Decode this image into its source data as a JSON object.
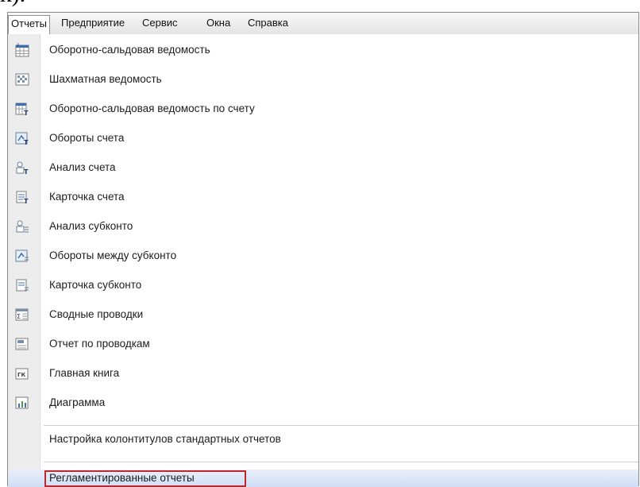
{
  "fragment_text": "к).",
  "menubar": {
    "items": [
      "Отчеты",
      "Предприятие",
      "Сервис",
      "Окна",
      "Справка"
    ]
  },
  "menu": {
    "items": [
      {
        "label": "Оборотно-сальдовая ведомость",
        "icon": "turnover-balance-icon"
      },
      {
        "label": "Шахматная ведомость",
        "icon": "chess-sheet-icon"
      },
      {
        "label": "Оборотно-сальдовая ведомость по счету",
        "icon": "account-turnover-balance-icon"
      },
      {
        "label": "Обороты счета",
        "icon": "account-turnover-icon"
      },
      {
        "label": "Анализ счета",
        "icon": "account-analysis-icon"
      },
      {
        "label": "Карточка счета",
        "icon": "account-card-icon"
      },
      {
        "label": "Анализ субконто",
        "icon": "subconto-analysis-icon"
      },
      {
        "label": "Обороты между субконто",
        "icon": "subconto-turnover-icon"
      },
      {
        "label": "Карточка субконто",
        "icon": "subconto-card-icon"
      },
      {
        "label": "Сводные проводки",
        "icon": "summary-entries-icon"
      },
      {
        "label": "Отчет по проводкам",
        "icon": "entries-report-icon"
      },
      {
        "label": "Главная книга",
        "icon": "general-ledger-icon"
      },
      {
        "label": "Диаграмма",
        "icon": "diagram-icon"
      }
    ],
    "header_footer_settings": "Настройка колонтитулов стандартных отчетов",
    "regulated_reports": "Регламентированные отчеты"
  },
  "colors": {
    "highlight_border": "#c0272d",
    "hover_background": "#cfddf5",
    "icon_blue": "#3d6fb6"
  }
}
